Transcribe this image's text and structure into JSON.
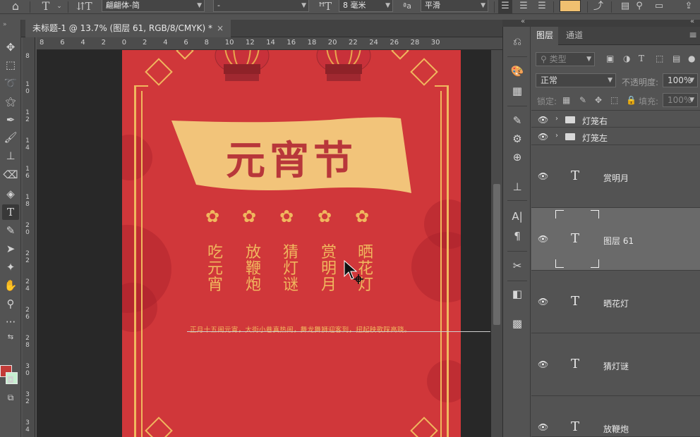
{
  "options_bar": {
    "font_family": "翩翩体-简",
    "font_style": "-",
    "font_size": "8 毫米",
    "aa_label": "ªa",
    "antialias": "平滑",
    "text_color": "#f0c070"
  },
  "document": {
    "tab_title": "未标题-1 @ 13.7% (图层 61, RGB/8/CMYK) *",
    "close_glyph": "×",
    "ruler_h": [
      "8",
      "6",
      "4",
      "2",
      "0",
      "2",
      "4",
      "6",
      "8",
      "10",
      "12",
      "14",
      "16",
      "18",
      "20",
      "22",
      "24",
      "26",
      "28",
      "30"
    ],
    "ruler_v": [
      "8",
      "1 0",
      "1 2",
      "1 4",
      "1 6",
      "1 8",
      "2 0",
      "2 2",
      "2 4",
      "2 6",
      "2 8",
      "3 0",
      "3 2",
      "3 4"
    ]
  },
  "poster": {
    "title": "元宵节",
    "columns": [
      [
        "吃",
        "元",
        "宵"
      ],
      [
        "放",
        "鞭",
        "炮"
      ],
      [
        "猜",
        "灯",
        "谜"
      ],
      [
        "赏",
        "明",
        "月"
      ],
      [
        "晒",
        "花",
        "灯"
      ]
    ],
    "bottom_text": "正月十五闹元宵，大街小巷真热闹，舞龙舞狮迎客到，扭起秧歌踩高跷。",
    "colors": {
      "background": "#d0373a",
      "gold": "#f0b75e",
      "banner": "#f2c47a"
    }
  },
  "panel": {
    "tabs": [
      "图层",
      "通道"
    ],
    "filter_placeholder": "类型",
    "blend_mode": "正常",
    "opacity_label": "不透明度:",
    "opacity_value": "100%",
    "lock_label": "锁定:",
    "fill_label": "填充:",
    "fill_value": "100%",
    "layers": [
      {
        "name": "灯笼右",
        "type": "group"
      },
      {
        "name": "灯笼左",
        "type": "group"
      },
      {
        "name": "赏明月",
        "type": "text"
      },
      {
        "name": "图层 61",
        "type": "text",
        "selected": true
      },
      {
        "name": "晒花灯",
        "type": "text"
      },
      {
        "name": "猜灯谜",
        "type": "text"
      },
      {
        "name": "放鞭炮",
        "type": "text"
      }
    ]
  },
  "colors": {
    "foreground": "#c23b38",
    "background": "#c6efd0"
  }
}
